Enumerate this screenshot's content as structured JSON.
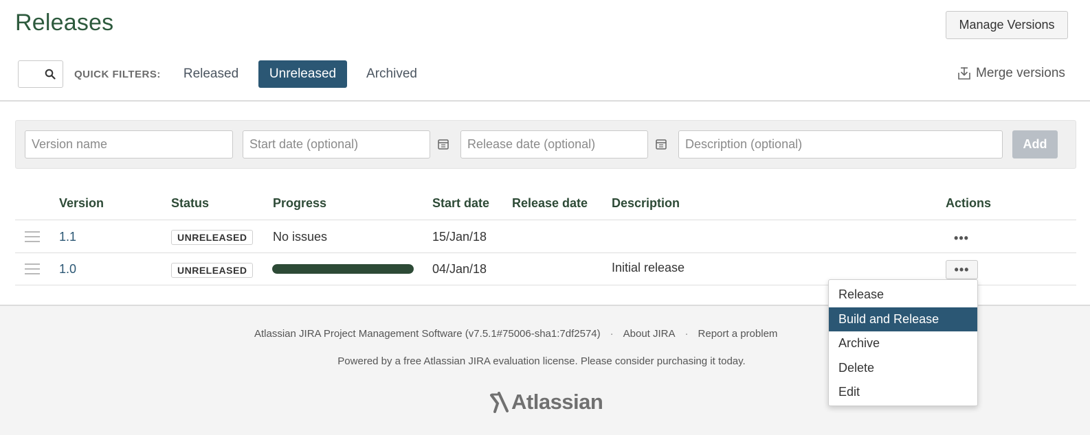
{
  "header": {
    "title": "Releases",
    "manage_versions": "Manage Versions"
  },
  "filters": {
    "label": "QUICK FILTERS:",
    "tabs": [
      "Released",
      "Unreleased",
      "Archived"
    ],
    "active_tab": "Unreleased",
    "merge": "Merge versions"
  },
  "add_form": {
    "version_placeholder": "Version name",
    "start_placeholder": "Start date (optional)",
    "release_placeholder": "Release date (optional)",
    "description_placeholder": "Description (optional)",
    "add_label": "Add"
  },
  "table": {
    "columns": [
      "Version",
      "Status",
      "Progress",
      "Start date",
      "Release date",
      "Description",
      "Actions"
    ],
    "rows": [
      {
        "version": "1.1",
        "status": "UNRELEASED",
        "progress_text": "No issues",
        "start_date": "15/Jan/18",
        "release_date": "",
        "description": ""
      },
      {
        "version": "1.0",
        "status": "UNRELEASED",
        "progress": 1.0,
        "start_date": "04/Jan/18",
        "release_date": "",
        "description": "Initial release"
      }
    ],
    "actions_glyph": "•••"
  },
  "dropdown": {
    "items": [
      "Release",
      "Build and Release",
      "Archive",
      "Delete",
      "Edit"
    ],
    "highlighted": "Build and Release"
  },
  "footer": {
    "software": "Atlassian JIRA Project Management Software (v7.5.1#75006-sha1:7df2574)",
    "sep": "·",
    "about": "About JIRA",
    "report": "Report a problem",
    "license": "Powered by a free Atlassian JIRA evaluation license. Please consider purchasing it today.",
    "logo": "Atlassian"
  },
  "colors": {
    "primary": "#2b5774",
    "title": "#2d5a3d",
    "progress": "#2d4a36"
  }
}
